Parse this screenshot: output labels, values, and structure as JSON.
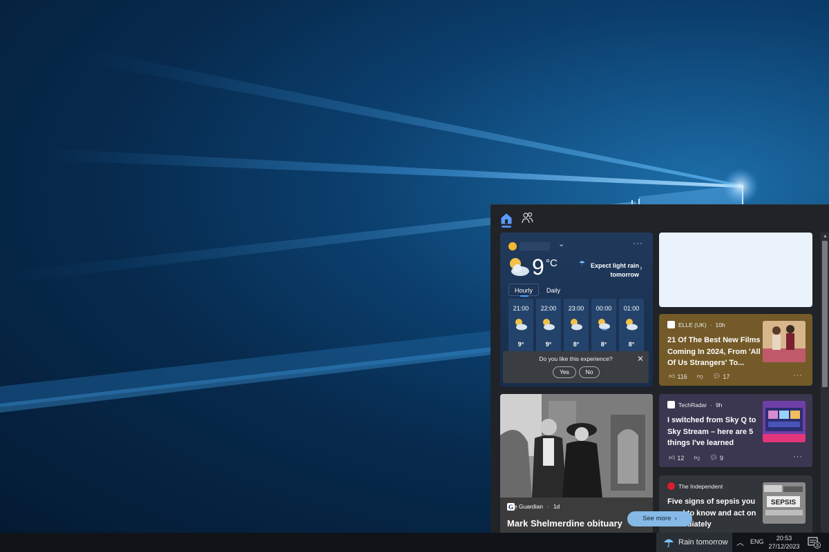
{
  "taskbar": {
    "weather_label": "Rain tomorrow",
    "language": "ENG",
    "time": "20:53",
    "date": "27/12/2023",
    "notification_count": "3"
  },
  "weather": {
    "temperature": "9",
    "unit": "°C",
    "forecast": "Expect light rain tomorrow",
    "tabs": [
      "Hourly",
      "Daily"
    ],
    "active_tab": "Hourly",
    "hourly": [
      {
        "time": "21:00",
        "temp": "9°",
        "icon": "partly-cloudy-night-icon"
      },
      {
        "time": "22:00",
        "temp": "9°",
        "icon": "partly-cloudy-night-icon"
      },
      {
        "time": "23:00",
        "temp": "8°",
        "icon": "partly-cloudy-night-icon"
      },
      {
        "time": "00:00",
        "temp": "8°",
        "icon": "rain-night-icon"
      },
      {
        "time": "01:00",
        "temp": "8°",
        "icon": "partly-cloudy-night-icon"
      }
    ],
    "feedback": {
      "question": "Do you like this experience?",
      "yes": "Yes",
      "no": "No"
    }
  },
  "news": [
    {
      "source": "ELLE (UK)",
      "age": "10h",
      "title": "21 Of The Best New Films Coming In 2024, From 'All Of Us Strangers' To...",
      "likes": "116",
      "comments": "17"
    },
    {
      "source": "TechRadar",
      "age": "9h",
      "title": "I switched from Sky Q to Sky Stream – here are 5 things I've learned",
      "likes": "12",
      "comments": "9"
    },
    {
      "source": "The Independent",
      "title": "Five signs of sepsis you need to know and act on immediately",
      "thumb_text": "SEPSIS"
    }
  ],
  "feature": {
    "source": "The Guardian",
    "age": "1d",
    "title": "Mark Shelmerdine obituary"
  },
  "see_more": "See more",
  "colors": {
    "accent": "#4a8cff",
    "elle_card": "#735a28",
    "techradar_card": "#3b3751",
    "see_more_bg": "#86b9e6"
  }
}
